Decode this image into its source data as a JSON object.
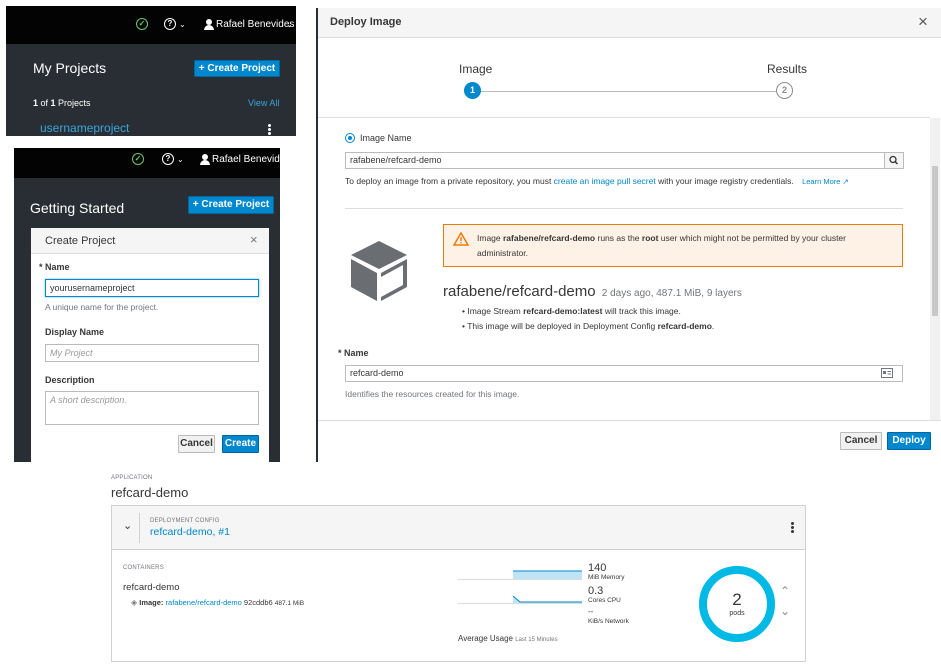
{
  "colors": {
    "accent": "#0088ce",
    "masthead": "#030303",
    "nav_dark": "#292e34",
    "success": "#6ec664",
    "warning": "#ec7a08",
    "donut": "#00b9e4"
  },
  "masthead": {
    "user_name": "Rafael Benevides"
  },
  "my_projects": {
    "title": "My Projects",
    "create_button": "Create Project",
    "count_pre": "1",
    "count_mid": " of ",
    "count_total": "1",
    "count_post": " Projects",
    "view_all": "View All",
    "project_name": "usernameproject"
  },
  "getting_started": {
    "title": "Getting Started",
    "create_button": "Create Project",
    "modal": {
      "title": "Create Project",
      "name_label": "Name",
      "name_value": "yourusernameproject",
      "name_help": "A unique name for the project.",
      "display_label": "Display Name",
      "display_placeholder": "My Project",
      "desc_label": "Description",
      "desc_placeholder": "A short description.",
      "cancel": "Cancel",
      "create": "Create"
    }
  },
  "deploy": {
    "title": "Deploy Image",
    "steps": [
      {
        "label": "Image",
        "num": "1"
      },
      {
        "label": "Results",
        "num": "2"
      }
    ],
    "radio_label": "Image Name",
    "image_value": "rafabene/refcard-demo",
    "help_pre": "To deploy an image from a private repository, you must ",
    "help_link": "create an image pull secret",
    "help_post": " with your image registry credentials.",
    "learn_more": "Learn More",
    "warning": {
      "pre": "Image ",
      "image": "rafabene/refcard-demo",
      "mid": " runs as the ",
      "root": "root",
      "post": " user which might not be permitted by your cluster",
      "line2": "administrator."
    },
    "image_title": "rafabene/refcard-demo",
    "image_meta": "2 days ago, 487.1 MiB, 9 layers",
    "bullet1_pre": "Image Stream ",
    "bullet1_bold": "refcard-demo:latest",
    "bullet1_post": " will track this image.",
    "bullet2_pre": "This image will be deployed in Deployment Config ",
    "bullet2_bold": "refcard-demo",
    "bullet2_post": ".",
    "name_label": "Name",
    "name_value": "refcard-demo",
    "name_help": "Identifies the resources created for this image.",
    "cancel": "Cancel",
    "deploy": "Deploy"
  },
  "application": {
    "caption": "Application",
    "name": "refcard-demo",
    "dc_caption": "Deployment Config",
    "dc_name": "refcard-demo, #1",
    "containers_caption": "Containers",
    "container_name": "refcard-demo",
    "image_label": "Image:",
    "image_link": "rafabene/refcard-demo",
    "image_hash": "92cddb6",
    "image_size": "487.1 MiB",
    "memory_value": "140",
    "memory_unit": "MiB Memory",
    "cpu_value": "0.3",
    "cpu_unit": "Cores CPU",
    "network_value": "--",
    "network_unit": "KiB/s Network",
    "avg_usage": "Average Usage",
    "avg_period": "Last 15 Minutes",
    "pods_count": "2",
    "pods_label": "pods"
  }
}
